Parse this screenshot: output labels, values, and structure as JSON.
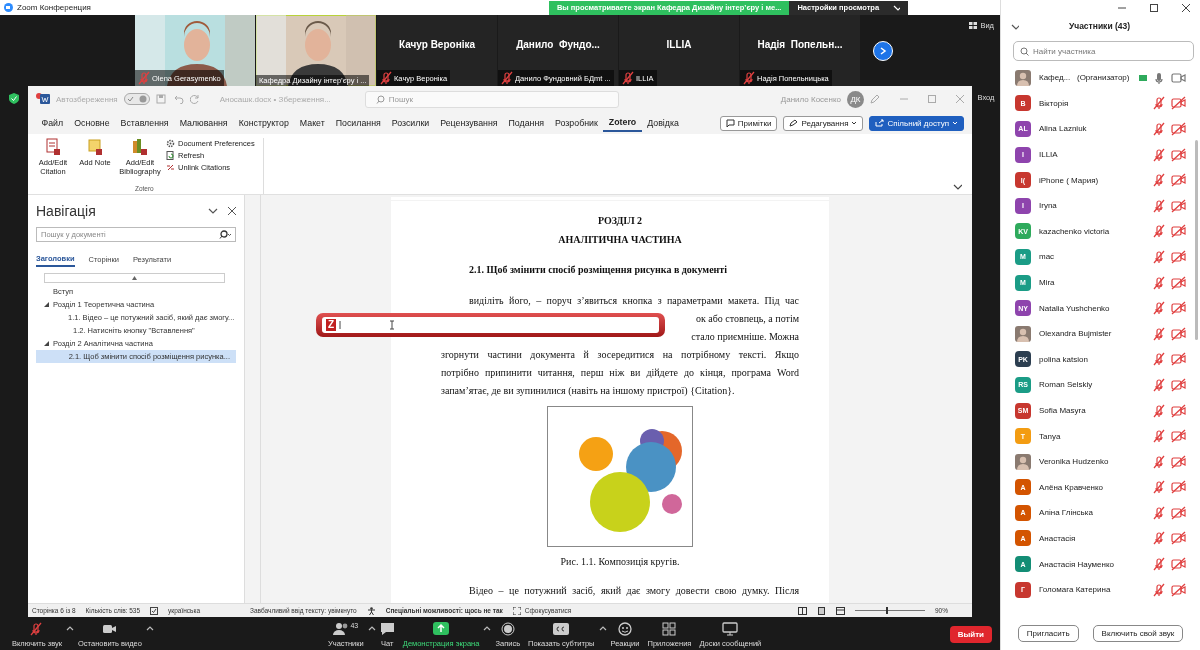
{
  "zoom_window": {
    "title": "Zoom Конференция"
  },
  "share_banner": {
    "text": "Вы просматриваете экран Кафедра Дизайну інтер’єру і ме...",
    "button": "Настройки просмотра"
  },
  "video_tiles": [
    {
      "kind": "video",
      "name": "Olena Gerasymenko",
      "muted": true,
      "active": false
    },
    {
      "kind": "video",
      "name": "Кафедра Дизайну інтер’єру і ...",
      "muted": false,
      "active": true
    },
    {
      "kind": "name",
      "display_name": "Качур Вероніка",
      "name": "Качур Вероніка",
      "muted": true,
      "active": false
    },
    {
      "kind": "name",
      "display_name": "Данило  Фундо...",
      "name": "Данило Фундовний БДmt ...",
      "muted": true,
      "active": false
    },
    {
      "kind": "name",
      "display_name": "ILLIA",
      "name": "ILLIA",
      "muted": true,
      "active": false
    },
    {
      "kind": "name",
      "display_name": "Надія  Попельн...",
      "name": "Надія Попельницька",
      "muted": true,
      "active": false
    }
  ],
  "view_button": "Вид",
  "shared_screen": {
    "sign_in": "Вход",
    "word": {
      "autosave": {
        "label": "Автозбереження",
        "on": true
      },
      "file_name": "Аносашк.docx • Збереження...",
      "search_placeholder": "Пошук",
      "user": "Данило Косенко",
      "user_initials": "ДК",
      "tabs": [
        {
          "label": "Файл",
          "selected": false
        },
        {
          "label": "Основне",
          "selected": false
        },
        {
          "label": "Вставлення",
          "selected": false
        },
        {
          "label": "Малювання",
          "selected": false
        },
        {
          "label": "Конструктор",
          "selected": false
        },
        {
          "label": "Макет",
          "selected": false
        },
        {
          "label": "Посилання",
          "selected": false
        },
        {
          "label": "Розсилки",
          "selected": false
        },
        {
          "label": "Рецензування",
          "selected": false
        },
        {
          "label": "Подання",
          "selected": false
        },
        {
          "label": "Розробник",
          "selected": false
        },
        {
          "label": "Zotero",
          "selected": true
        },
        {
          "label": "Довідка",
          "selected": false
        }
      ],
      "ribbon_buttons": [
        {
          "kind": "comments",
          "label": "Примітки"
        },
        {
          "kind": "editing",
          "label": "Редагування"
        },
        {
          "kind": "share",
          "label": "Спільний доступ"
        }
      ],
      "ribbon_group": {
        "name": "Zotero",
        "large": [
          {
            "kind": "citation",
            "label": "Add/Edit Citation"
          },
          {
            "kind": "note",
            "label": "Add Note"
          },
          {
            "kind": "bibliography",
            "label": "Add/Edit Bibliography"
          }
        ],
        "small": [
          {
            "kind": "preferences",
            "label": "Document Preferences"
          },
          {
            "kind": "refresh",
            "label": "Refresh"
          },
          {
            "kind": "unlink",
            "label": "Unlink Citations"
          }
        ]
      },
      "navigation": {
        "title": "Навігація",
        "search_placeholder": "Пошук у документі",
        "tabs": [
          {
            "label": "Заголовки",
            "selected": true
          },
          {
            "label": "Сторінки",
            "selected": false
          },
          {
            "label": "Результати",
            "selected": false
          }
        ],
        "headings": [
          {
            "text": "Вступ",
            "selected": false
          },
          {
            "text": "Розділ 1  Теоретична частина",
            "selected": false,
            "expanded": true,
            "children": [
              {
                "text": "1.1. Відео – це потужний засіб, який дає змогу...",
                "selected": false
              },
              {
                "text": "1.2. Натисніть кнопку \"Вставлення\"",
                "selected": false
              }
            ]
          },
          {
            "text": "Розділ 2  Аналітична частина",
            "selected": false,
            "expanded": true,
            "children": [
              {
                "text": "2.1. Щоб змінити спосіб розміщення рисунка...",
                "selected": true
              }
            ]
          }
        ]
      },
      "document": {
        "chapter": "РОЗДІЛ 2",
        "chapter_title": "АНАЛІТИЧНА ЧАСТИНА",
        "section": "2.1. Щоб змінити спосіб розміщення рисунка в документі",
        "lines": [
          {
            "kind": "first",
            "text": "виділіть його, – поруч з’явиться кнопка з параметрами макета. Під час"
          },
          {
            "kind": "right",
            "text": "ок або стовпець, а потім"
          },
          {
            "kind": "right",
            "text": "стало приємніше. Можна"
          },
          {
            "kind": "full",
            "text": "згорнути частини документа й зосередитися на потрібному тексті. Якщо"
          },
          {
            "kind": "full",
            "text": "потрібно припинити читання, перш ніж ви дійдете до кінця, програма Word"
          },
          {
            "kind": "last",
            "text": "запам’ятає, де ви зупинилися (навіть на іншому пристрої) {Citation}."
          }
        ],
        "caption": "Рис. 1.1. Композиція кругів.",
        "next_line": "Відео – це потужний засіб, який дає змогу довести свою думку. Після"
      },
      "zotero_bar": {
        "logo": "Z"
      },
      "status_bar": {
        "page": "Сторінка 6 із 8",
        "words": "Кількість слів: 535",
        "language": "українська",
        "predictions": "Завбачливий ввід тексту: увімкнуто",
        "accessibility": "Спеціальні можливості: щось не так",
        "focus": "Сфокусуватися",
        "zoom": "90%",
        "zoom_slider": {
          "level": 0.45
        }
      }
    }
  },
  "toolbar": {
    "items": [
      {
        "kind": "mic_muted",
        "label": "Включить звук",
        "caret": true
      },
      {
        "kind": "video",
        "label": "Остановить видео",
        "caret": true
      },
      {
        "kind": "participants",
        "label": "Участники",
        "count": "43",
        "caret": true
      },
      {
        "kind": "chat",
        "label": "Чат",
        "caret": false
      },
      {
        "kind": "share",
        "label": "Демонстрация экрана",
        "caret": true
      },
      {
        "kind": "record",
        "label": "Запись",
        "caret": false
      },
      {
        "kind": "cc",
        "label": "Показать субтитры",
        "caret": true
      },
      {
        "kind": "reactions",
        "label": "Реакции",
        "caret": false
      },
      {
        "kind": "apps",
        "label": "Приложения",
        "caret": false
      },
      {
        "kind": "whiteboard",
        "label": "Доски сообщений",
        "caret": false
      }
    ],
    "leave": "Выйти"
  },
  "participants_panel": {
    "title": "Участники (43)",
    "search_placeholder": "Найти участника",
    "participants": [
      {
        "name": "Кафед...",
        "role": "(Организатор)",
        "muted": false,
        "video_off": false
      },
      {
        "kind": "initials",
        "initials": "В",
        "color": "#c7372f",
        "name": "Вікторія",
        "muted": true,
        "video_off": true
      },
      {
        "kind": "initials",
        "initials": "AL",
        "color": "#8e44ad",
        "name": "Alina Lazniuk",
        "muted": true,
        "video_off": true
      },
      {
        "kind": "initials",
        "initials": "I",
        "color": "#8e44ad",
        "name": "ILLIA",
        "muted": true,
        "video_off": true
      },
      {
        "kind": "initials",
        "initials": "I(",
        "color": "#c7372f",
        "name": "iPhone ( Мария)",
        "muted": true,
        "video_off": true
      },
      {
        "kind": "initials",
        "initials": "I",
        "color": "#8e44ad",
        "name": "Iryna",
        "muted": true,
        "video_off": true
      },
      {
        "kind": "initials",
        "initials": "KV",
        "color": "#2eaa5c",
        "name": "kazachenko victoria",
        "muted": true,
        "video_off": true
      },
      {
        "kind": "initials",
        "initials": "M",
        "color": "#1b9c86",
        "name": "mac",
        "muted": true,
        "video_off": true
      },
      {
        "kind": "initials",
        "initials": "M",
        "color": "#1b9c86",
        "name": "Mira",
        "muted": true,
        "video_off": true
      },
      {
        "kind": "initials",
        "initials": "NY",
        "color": "#8e44ad",
        "name": "Natalia Yushchenko",
        "muted": true,
        "video_off": true
      },
      {
        "name": "Olexandra Bujmister",
        "muted": true,
        "video_off": true
      },
      {
        "kind": "initials",
        "initials": "PK",
        "color": "#2c3e50",
        "name": "polina katsion",
        "muted": true,
        "video_off": true
      },
      {
        "kind": "initials",
        "initials": "RS",
        "color": "#1b9c86",
        "name": "Roman Selskiy",
        "muted": true,
        "video_off": true
      },
      {
        "kind": "initials",
        "initials": "SM",
        "color": "#c7372f",
        "name": "Sofia Masyra",
        "muted": true,
        "video_off": true
      },
      {
        "kind": "initials",
        "initials": "T",
        "color": "#f39c12",
        "name": "Tanya",
        "muted": true,
        "video_off": true
      },
      {
        "name": "Veronika Hudzenko",
        "muted": true,
        "video_off": true
      },
      {
        "kind": "initials",
        "initials": "A",
        "color": "#d35400",
        "name": "Алёна Кравченко",
        "muted": true,
        "video_off": true
      },
      {
        "kind": "initials",
        "initials": "A",
        "color": "#d35400",
        "name": "Аліна Глінська",
        "muted": true,
        "video_off": true
      },
      {
        "kind": "initials",
        "initials": "A",
        "color": "#d35400",
        "name": "Анастасія",
        "muted": true,
        "video_off": true
      },
      {
        "kind": "initials",
        "initials": "A",
        "color": "#138d75",
        "name": "Анастасія Науменко",
        "muted": true,
        "video_off": true
      },
      {
        "kind": "initials",
        "initials": "Г",
        "color": "#c7372f",
        "name": "Голомага Катерина",
        "muted": true,
        "video_off": true
      }
    ],
    "buttons": [
      "Пригласить",
      "Включить свой звук"
    ]
  }
}
